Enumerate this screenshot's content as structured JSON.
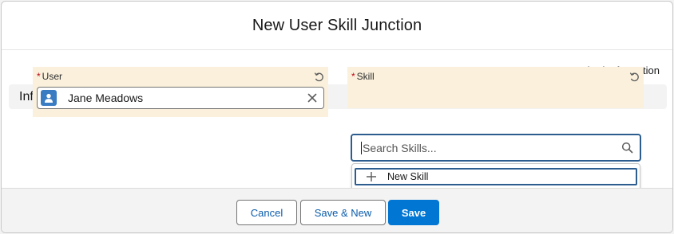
{
  "modal": {
    "title": "New User Skill Junction"
  },
  "required_note": {
    "star": "*",
    "text": "= Required Information"
  },
  "section": {
    "title": "Information"
  },
  "fields": {
    "user": {
      "required_star": "*",
      "label": "User",
      "value": "Jane Meadows",
      "avatar_icon": "user-avatar-icon",
      "clear_icon": "close-icon",
      "undo_icon": "undo-icon"
    },
    "skill": {
      "required_star": "*",
      "label": "Skill",
      "placeholder": "Search Skills...",
      "value": "",
      "search_icon": "search-icon",
      "undo_icon": "undo-icon"
    }
  },
  "dropdown": {
    "items": [
      {
        "icon": "plus-icon",
        "label": "New Skill"
      }
    ]
  },
  "footer": {
    "cancel_label": "Cancel",
    "save_new_label": "Save & New",
    "save_label": "Save"
  },
  "colors": {
    "brand": "#0176d3",
    "link_text": "#0b5cab",
    "required": "#ba0517",
    "field_highlight": "#faf0dc",
    "focus_border": "#2d5d8f",
    "avatar": "#3a7cc2"
  }
}
